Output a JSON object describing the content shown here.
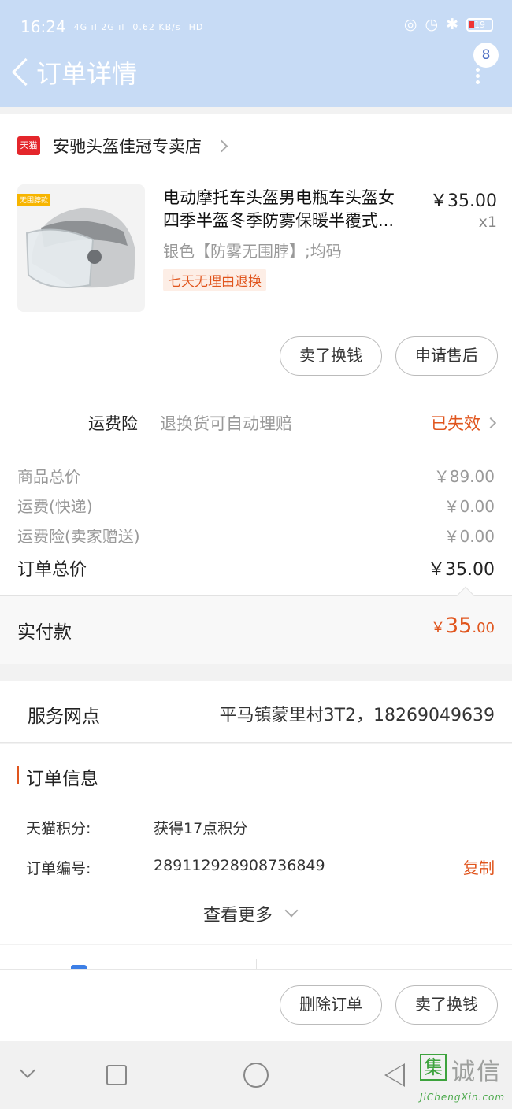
{
  "status_bar": {
    "time": "16:24",
    "signal": "4G ıl 2G ıl",
    "speed": "0.62 KB/s",
    "hd": "HD",
    "battery": "19"
  },
  "header": {
    "title": "订单详情",
    "badge_count": "8"
  },
  "shop": {
    "badge": "天猫",
    "name": "安驰头盔佳冠专卖店"
  },
  "product": {
    "thumb_tag": "无围脖款",
    "title_line1": "电动摩托车头盔男电瓶车头盔女",
    "title_line2": "四季半盔冬季防雾保暖半覆式...",
    "price": "￥35.00",
    "quantity": "x1",
    "spec": "银色【防雾无围脖】;均码",
    "return_tag": "七天无理由退换"
  },
  "actions": {
    "sell_label": "卖了换钱",
    "after_sale_label": "申请售后"
  },
  "insurance": {
    "label": "运费险",
    "desc": "退换货可自动理赔",
    "status": "已失效"
  },
  "fees": {
    "items_total_label": "商品总价",
    "items_total": "￥89.00",
    "shipping_label": "运费(快递)",
    "shipping": "￥0.00",
    "insurance_label": "运费险(卖家赠送)",
    "insurance": "￥0.00",
    "order_total_label": "订单总价",
    "order_total": "￥35.00"
  },
  "paid": {
    "label": "实付款",
    "currency": "￥",
    "amount_int": "35",
    "amount_dec": ".00"
  },
  "service": {
    "label": "服务网点",
    "value": "平马镇蒙里村3T2，18269049639"
  },
  "order_info": {
    "title": "订单信息",
    "points_label": "天猫积分:",
    "points_value": "获得17点积分",
    "number_label": "订单编号:",
    "number_value": "289112928908736849",
    "copy_label": "复制",
    "see_more": "查看更多"
  },
  "bottom": {
    "delete_label": "删除订单",
    "sell_label": "卖了换钱"
  },
  "watermark": {
    "box_char": "集",
    "text": "诚信",
    "url": "JiChengXin.com"
  },
  "colors": {
    "header_bg": "#c7dbf5",
    "accent": "#e0551d",
    "tmall_red": "#e4262b"
  }
}
